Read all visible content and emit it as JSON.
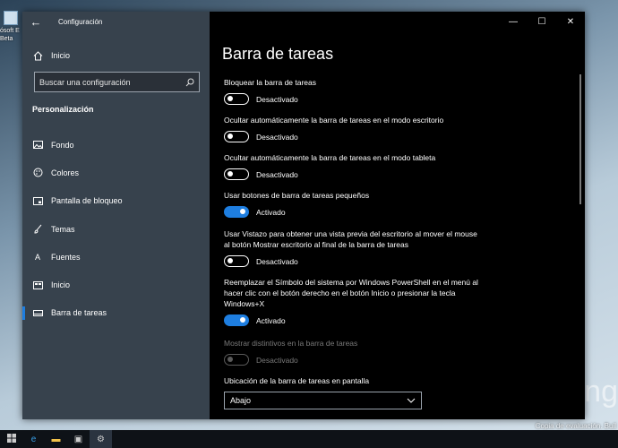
{
  "desktop": {
    "icon_label": "ósoft E\nBeta",
    "watermark": "Copia de evaluación. Buil",
    "bing_text": "Bing"
  },
  "window": {
    "title": "Configuración",
    "controls": {
      "minimize": "—",
      "maximize": "☐",
      "close": "✕"
    }
  },
  "sidebar": {
    "back_icon": "arrow-left-icon",
    "home_label": "Inicio",
    "search_placeholder": "Buscar una configuración",
    "section_heading": "Personalización",
    "items": [
      {
        "label": "Fondo",
        "icon": "image-icon"
      },
      {
        "label": "Colores",
        "icon": "palette-icon"
      },
      {
        "label": "Pantalla de bloqueo",
        "icon": "lock-screen-icon"
      },
      {
        "label": "Temas",
        "icon": "brush-icon"
      },
      {
        "label": "Fuentes",
        "icon": "font-icon"
      },
      {
        "label": "Inicio",
        "icon": "start-icon"
      },
      {
        "label": "Barra de tareas",
        "icon": "taskbar-icon",
        "active": true
      }
    ]
  },
  "main": {
    "title": "Barra de tareas",
    "settings": [
      {
        "label": "Bloquear la barra de tareas",
        "state": "Desactivado",
        "on": false,
        "enabled": true
      },
      {
        "label": "Ocultar automáticamente la barra de tareas en el modo escritorio",
        "state": "Desactivado",
        "on": false,
        "enabled": true
      },
      {
        "label": "Ocultar automáticamente la barra de tareas en el modo tableta",
        "state": "Desactivado",
        "on": false,
        "enabled": true
      },
      {
        "label": "Usar botones de barra de tareas pequeños",
        "state": "Activado",
        "on": true,
        "enabled": true
      },
      {
        "label": "Usar Vistazo para obtener una vista previa del escritorio al mover el mouse al botón Mostrar escritorio al final de la barra de tareas",
        "state": "Desactivado",
        "on": false,
        "enabled": true
      },
      {
        "label": "Reemplazar el Símbolo del sistema por Windows PowerShell en el menú al hacer clic con el botón derecho en el botón Inicio o presionar la tecla Windows+X",
        "state": "Activado",
        "on": true,
        "enabled": true
      },
      {
        "label": "Mostrar distintivos en la barra de tareas",
        "state": "Desactivado",
        "on": false,
        "enabled": false
      }
    ],
    "location": {
      "label": "Ubicación de la barra de tareas en pantalla",
      "value": "Abajo"
    }
  },
  "colors": {
    "accent": "#1e7ee0",
    "sidebar_bg": "#3a4652",
    "content_bg": "#000000"
  }
}
